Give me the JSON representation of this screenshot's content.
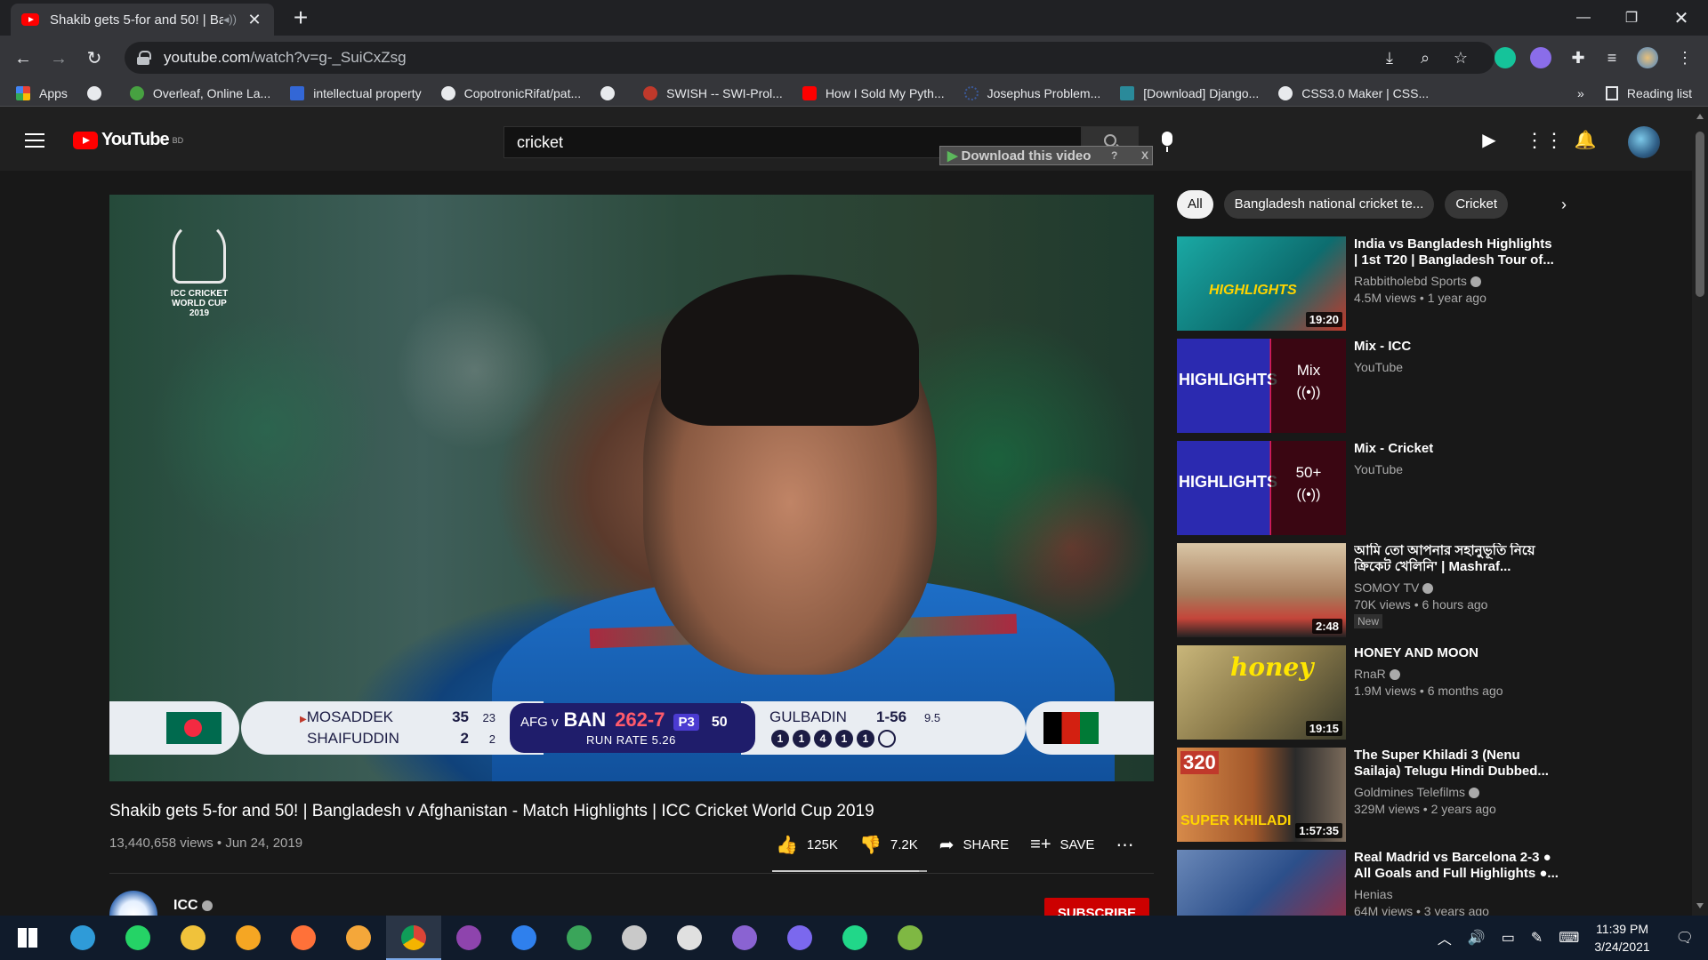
{
  "browser": {
    "tab_title": "Shakib gets 5-for and 50! | Ba",
    "url_domain": "youtube.com",
    "url_path": "/watch?v=g-_SuiCxZsg",
    "bookmarks": [
      {
        "label": "Apps",
        "color": "#e94235"
      },
      {
        "label": "",
        "color": "#e8eaed"
      },
      {
        "label": "Overleaf, Online La...",
        "color": "#47a141"
      },
      {
        "label": "intellectual property",
        "color": "#3367d6"
      },
      {
        "label": "CopotronicRifat/pat...",
        "color": "#e8eaed"
      },
      {
        "label": "",
        "color": "#e8eaed"
      },
      {
        "label": "SWISH -- SWI-Prol...",
        "color": "#c0392b"
      },
      {
        "label": "How I Sold My Pyth...",
        "color": "#ff0000"
      },
      {
        "label": "Josephus Problem...",
        "color": "#3b5998"
      },
      {
        "label": "[Download] Django...",
        "color": "#2a8a9a"
      },
      {
        "label": "CSS3.0 Maker | CSS...",
        "color": "#e8eaed"
      }
    ],
    "bookmarks_overflow": "»",
    "reading_list": "Reading list"
  },
  "youtube": {
    "logo_text": "YouTube",
    "logo_country": "BD",
    "search_value": "cricket",
    "download_overlay": "Download this video",
    "download_overlay_extra": "?",
    "download_overlay_close": "X"
  },
  "video": {
    "overlay_logo": [
      "ICC CRICKET",
      "WORLD CUP",
      "2019"
    ],
    "scoreboard": {
      "bat1_name": "MOSADDEK",
      "bat1_runs": "35",
      "bat1_balls": "23",
      "bat2_name": "SHAIFUDDIN",
      "bat2_runs": "2",
      "bat2_balls": "2",
      "match": "AFG v",
      "team": "BAN",
      "score": "262-7",
      "powerplay": "P3",
      "overs": "50",
      "run_rate": "RUN RATE 5.26",
      "bowler_name": "GULBADIN",
      "bowler_figures": "1-56",
      "bowler_overs": "9.5",
      "balls": [
        "1",
        "1",
        "4",
        "1",
        "1",
        ""
      ]
    },
    "title": "Shakib gets 5-for and 50! | Bangladesh v Afghanistan - Match Highlights | ICC Cricket World Cup 2019",
    "meta": "13,440,658 views • Jun 24, 2019",
    "likes": "125K",
    "like_ratio": 0.95,
    "dislikes": "7.2K",
    "share": "SHARE",
    "save": "SAVE",
    "channel": "ICC",
    "subscribe": "SUBSCRIBE"
  },
  "chips": [
    "All",
    "Bangladesh national cricket te...",
    "Cricket"
  ],
  "recommendations": [
    {
      "title": "India vs Bangladesh Highlights | 1st T20 | Bangladesh Tour of...",
      "channel": "Rabbitholebd Sports",
      "verified": true,
      "stats": "4.5M views • 1 year ago",
      "duration": "19:20",
      "thumb_color": "#1aa9a4"
    },
    {
      "title": "Mix - ICC",
      "channel": "YouTube",
      "verified": false,
      "stats": "",
      "mix": "Mix",
      "thumb_color": "#2b2ab0"
    },
    {
      "title": "Mix - Cricket",
      "channel": "YouTube",
      "verified": false,
      "stats": "",
      "mix": "50+",
      "thumb_color": "#2b2ab0"
    },
    {
      "title": "আমি তো আপনার সহানুভূতি নিয়ে ক্রিকেট খেলিনি' | Mashraf...",
      "channel": "SOMOY TV",
      "verified": true,
      "stats": "70K views • 6 hours ago",
      "duration": "2:48",
      "badge": "New",
      "thumb_color": "#c4453a"
    },
    {
      "title": "HONEY AND MOON",
      "channel": "RnaR",
      "verified": true,
      "stats": "1.9M views • 6 months ago",
      "duration": "19:15",
      "thumb_color": "#8a7a4a"
    },
    {
      "title": "The Super Khiladi 3 (Nenu Sailaja) Telugu Hindi Dubbed...",
      "channel": "Goldmines Telefilms",
      "verified": true,
      "stats": "329M views • 2 years ago",
      "duration": "1:57:35",
      "thumb_color": "#a3582b"
    },
    {
      "title": "Real Madrid vs Barcelona 2-3 ● All Goals and Full Highlights ●...",
      "channel": "Henias",
      "verified": false,
      "stats": "64M views • 3 years ago",
      "duration": "",
      "thumb_color": "#2c4f8a"
    }
  ],
  "taskbar": {
    "apps": [
      {
        "name": "start",
        "color": "#ffffff"
      },
      {
        "name": "cortana",
        "color": "#2f9bd8"
      },
      {
        "name": "whatsapp",
        "color": "#25d366"
      },
      {
        "name": "file-explorer",
        "color": "#f0c23b"
      },
      {
        "name": "brave",
        "color": "#f5a623"
      },
      {
        "name": "firefox",
        "color": "#ff7139"
      },
      {
        "name": "app-orange",
        "color": "#f4a73a"
      },
      {
        "name": "chrome",
        "color": "#db4437"
      },
      {
        "name": "github-desktop",
        "color": "#8e44ad"
      },
      {
        "name": "vscode",
        "color": "#2f80ed"
      },
      {
        "name": "maps",
        "color": "#3aa55a"
      },
      {
        "name": "app-globe",
        "color": "#c9c9c9"
      },
      {
        "name": "inkscape",
        "color": "#e0e0e0"
      },
      {
        "name": "visual-studio",
        "color": "#8a63d2"
      },
      {
        "name": "messenger",
        "color": "#7b68ee"
      },
      {
        "name": "pycharm",
        "color": "#21d789"
      },
      {
        "name": "notepad",
        "color": "#7fb843"
      }
    ],
    "time": "11:39 PM",
    "date": "3/24/2021"
  }
}
